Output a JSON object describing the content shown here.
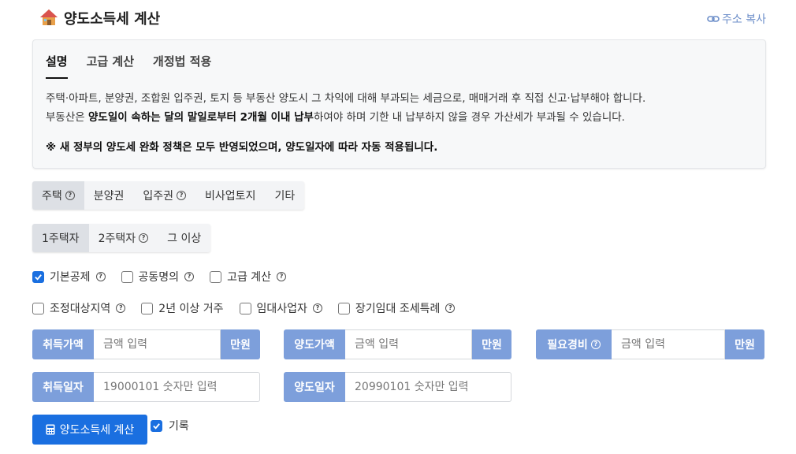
{
  "header": {
    "title": "양도소득세 계산",
    "icon": "house-icon",
    "copy_label": "주소 복사"
  },
  "info": {
    "tabs": [
      {
        "label": "설명",
        "active": true
      },
      {
        "label": "고급 계산",
        "active": false
      },
      {
        "label": "개정법 적용",
        "active": false
      }
    ],
    "line1": "주택·아파트, 분양권, 조합원 입주권, 토지 등 부동산 양도시 그 차익에 대해 부과되는 세금으로, 매매거래 후 직접 신고·납부해야 합니다.",
    "line2_pre": "부동산은 ",
    "line2_bold": "양도일이 속하는 달의 말일로부터 2개월 이내 납부",
    "line2_post": "하여야 하며 기한 내 납부하지 않을 경우 가산세가 부과될 수 있습니다.",
    "notice": "※ 새 정부의 양도세 완화 정책은 모두 반영되었으며, 양도일자에 따라 자동 적용됩니다."
  },
  "property_types": [
    {
      "label": "주택",
      "help": true,
      "active": true
    },
    {
      "label": "분양권",
      "help": false,
      "active": false
    },
    {
      "label": "입주권",
      "help": true,
      "active": false
    },
    {
      "label": "비사업토지",
      "help": false,
      "active": false
    },
    {
      "label": "기타",
      "help": false,
      "active": false
    }
  ],
  "house_counts": [
    {
      "label": "1주택자",
      "help": false,
      "active": true
    },
    {
      "label": "2주택자",
      "help": true,
      "active": false
    },
    {
      "label": "그 이상",
      "help": false,
      "active": false
    }
  ],
  "options_row1": [
    {
      "label": "기본공제",
      "checked": true
    },
    {
      "label": "공동명의",
      "checked": false
    },
    {
      "label": "고급 계산",
      "checked": false
    }
  ],
  "options_row2": [
    {
      "label": "조정대상지역",
      "checked": false,
      "help": true
    },
    {
      "label": "2년 이상 거주",
      "checked": false,
      "help": false
    },
    {
      "label": "임대사업자",
      "checked": false,
      "help": true
    },
    {
      "label": "장기임대 조세특례",
      "checked": false,
      "help": true
    }
  ],
  "fields": {
    "acquire_price": {
      "label": "취득가액",
      "placeholder": "금액 입력",
      "unit": "만원"
    },
    "transfer_price": {
      "label": "양도가액",
      "placeholder": "금액 입력",
      "unit": "만원"
    },
    "expenses": {
      "label": "필요경비",
      "placeholder": "금액 입력",
      "unit": "만원"
    },
    "acquire_date": {
      "label": "취득일자",
      "placeholder": "19000101 숫자만 입력"
    },
    "transfer_date": {
      "label": "양도일자",
      "placeholder": "20990101 숫자만 입력"
    }
  },
  "help_glyph": "?",
  "calc_button": {
    "label": "양도소득세 계산",
    "icon": "calculator-icon"
  },
  "record": {
    "label": "기록",
    "checked": true
  },
  "colors": {
    "accent": "#1a6fe0",
    "field_label": "#7d9fdb",
    "link": "#6c8ec9"
  }
}
